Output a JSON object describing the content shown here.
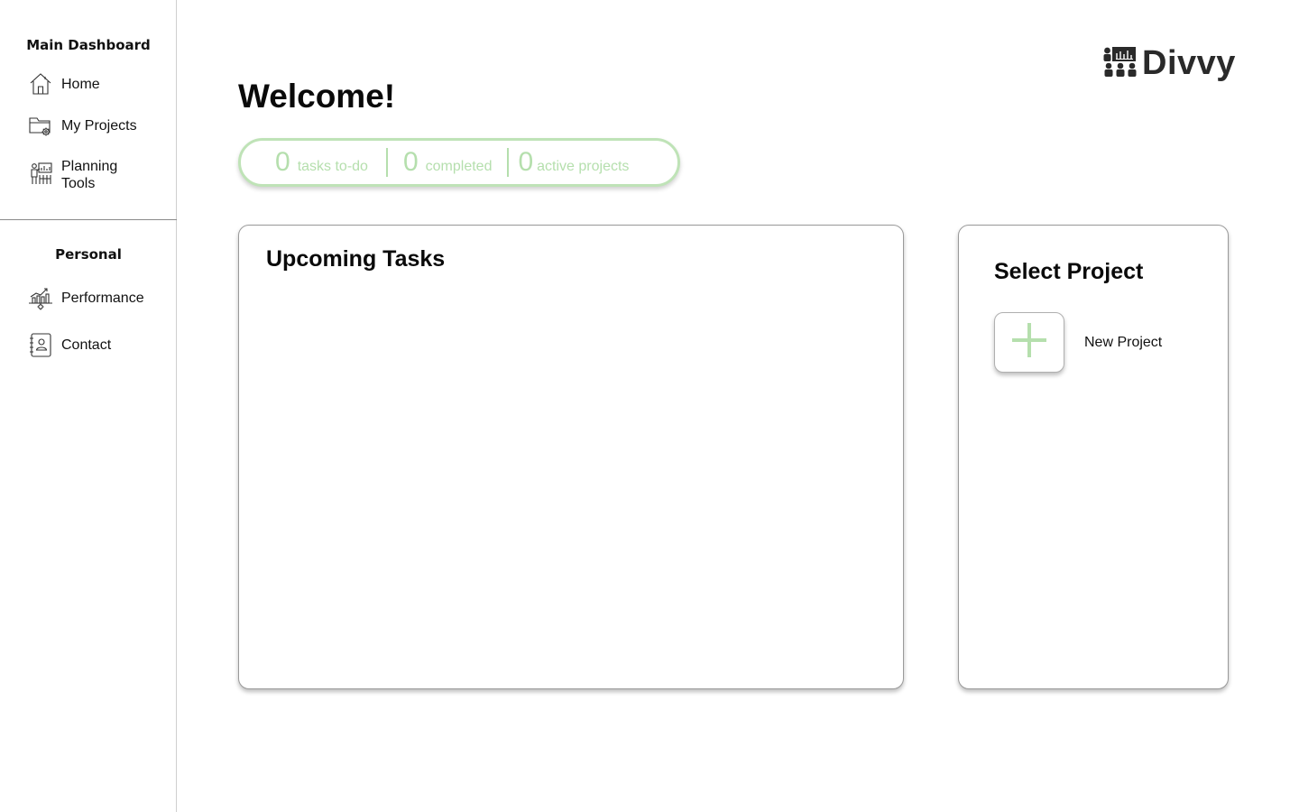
{
  "sidebar": {
    "main_section_title": "Main Dashboard",
    "main_items": [
      {
        "label": "Home",
        "icon": "home-icon"
      },
      {
        "label": "My Projects",
        "icon": "folder-gear-icon"
      },
      {
        "label": "Planning Tools",
        "icon": "planning-presentation-icon"
      }
    ],
    "personal_section_title": "Personal",
    "personal_items": [
      {
        "label": "Performance",
        "icon": "performance-chart-icon"
      },
      {
        "label": "Contact",
        "icon": "contact-book-icon"
      }
    ]
  },
  "header": {
    "welcome": "Welcome!",
    "brand": "Divvy"
  },
  "stats": {
    "tasks_todo": {
      "value": "0",
      "label": "tasks to-do"
    },
    "completed": {
      "value": "0",
      "label": "completed"
    },
    "active_projects": {
      "value": "0",
      "label": "active projects"
    }
  },
  "upcoming_tasks": {
    "title": "Upcoming Tasks"
  },
  "select_project": {
    "title": "Select Project",
    "new_project_label": "New Project"
  },
  "colors": {
    "accent_green": "#b5dfad",
    "text": "#111111",
    "logo": "#2a2a2a"
  }
}
